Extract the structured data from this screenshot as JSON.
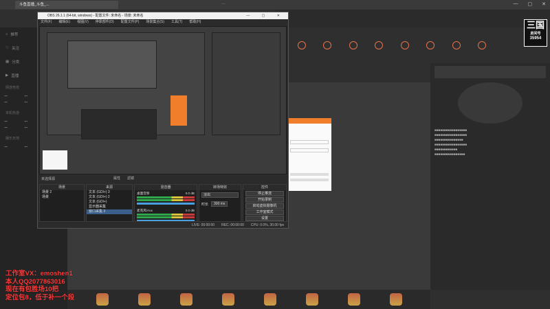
{
  "browser": {
    "tab_title": "斗鱼直播_斗鱼_...",
    "center_text": "…",
    "controls": [
      "—",
      "▢",
      "✕"
    ]
  },
  "sidebar": {
    "rows": [
      "推荐",
      "关注",
      "分类",
      "直播"
    ],
    "sections": [
      "网游竞技",
      "单机热游",
      "娱乐天地"
    ]
  },
  "site": {
    "nav": [
      "",
      "",
      "",
      "",
      "",
      "",
      "",
      ""
    ],
    "subscribe_btn": "订阅",
    "follow_btn": "关注"
  },
  "obs": {
    "title": "OBS 26.1.1 (64-bit, windows) - 配置文件: 未命名 - 场景: 未命名",
    "window_buttons": "— ▢ ✕",
    "menu": [
      "文件(F)",
      "编辑(E)",
      "视图(V)",
      "停靠部件(D)",
      "配置文件(P)",
      "场景集合(S)",
      "工具(T)",
      "帮助(H)"
    ],
    "scene_label": "未选择源",
    "tabs": [
      "属性",
      "滤镜"
    ],
    "docks": {
      "scenes": {
        "title": "场景",
        "items": [
          "场景 2",
          "场景"
        ],
        "footer": "+ − ∧ ∨"
      },
      "sources": {
        "title": "来源",
        "items": [
          "文本 (GDI+) 3",
          "文本 (GDI+) 2",
          "文本 (GDI+)",
          "显示器采集",
          "窗口采集 3"
        ],
        "footer": "+ − ⚙ ∧ ∨"
      },
      "mixer": {
        "title": "混音器",
        "channels": [
          {
            "name": "桌面音频",
            "db": "0.0 dB"
          },
          {
            "name": "麦克风/Aux",
            "db": "0.0 dB"
          }
        ]
      },
      "transitions": {
        "title": "转场特效",
        "type": "淡出",
        "duration_label": "时长",
        "duration": "300 ms"
      },
      "controls": {
        "title": "控件",
        "buttons": [
          "停止推流",
          "开始录制",
          "启动虚拟摄像机",
          "工作室模式",
          "设置",
          "退出"
        ]
      }
    },
    "status": [
      "LIVE: 00:00:00",
      "REC: 00:00:00",
      "CPU: 0.0%, 30.00 fps"
    ]
  },
  "overlay_lines": [
    "工作室VX：emoshen1",
    "本人QQ2077863016",
    "现在有包胜场10把",
    "定位包8，低于补一个段"
  ],
  "logo": {
    "big": "三国",
    "small": "房间号",
    "room_number": "35954"
  },
  "colors": {
    "accent": "#f07e2a",
    "overlay_red": "#ff3b3b",
    "obs_bg": "#2b2b2b"
  }
}
